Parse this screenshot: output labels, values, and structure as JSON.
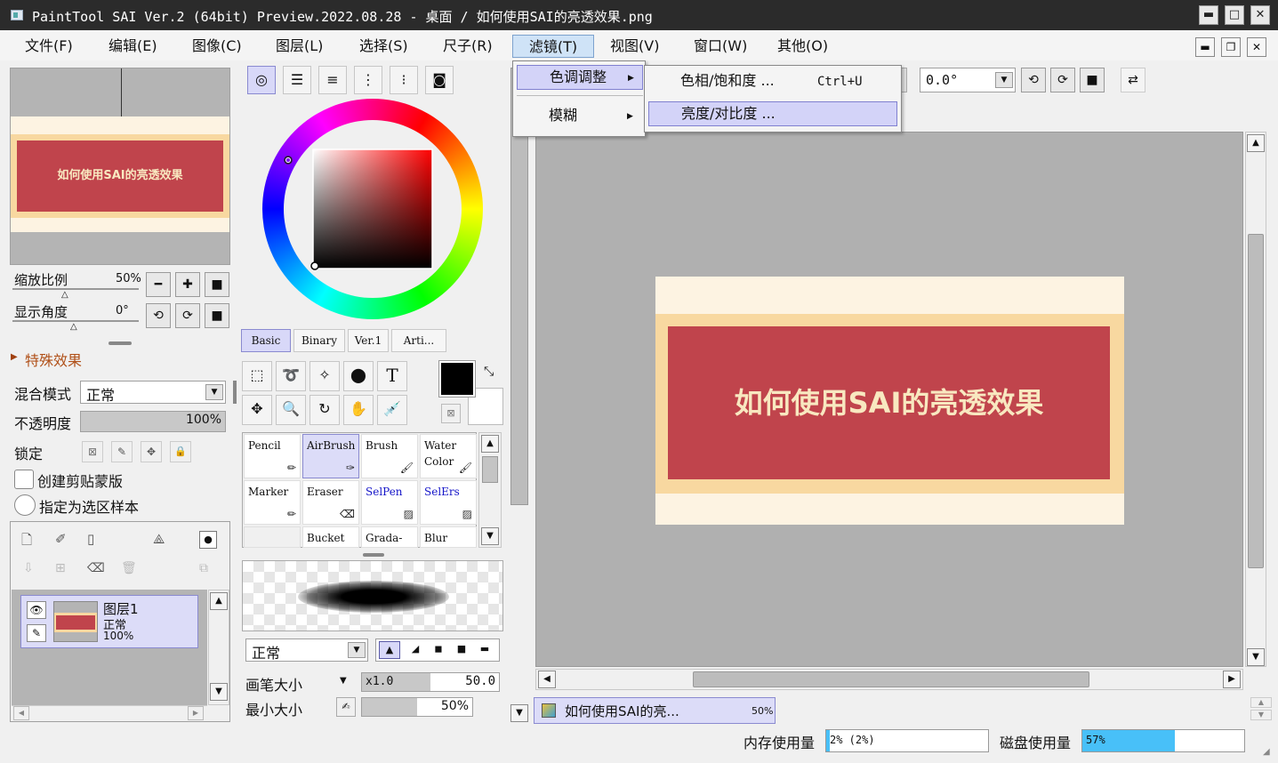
{
  "window": {
    "title": "PaintTool SAI Ver.2 (64bit) Preview.2022.08.28 - 桌面 / 如何使用SAI的亮透效果.png",
    "min_label": "▬",
    "max_label": "□",
    "close_label": "✕"
  },
  "menu": [
    {
      "label": "文件(F)"
    },
    {
      "label": "编辑(E)"
    },
    {
      "label": "图像(C)"
    },
    {
      "label": "图层(L)"
    },
    {
      "label": "选择(S)"
    },
    {
      "label": "尺子(R)"
    },
    {
      "label": "滤镜(T)"
    },
    {
      "label": "视图(V)"
    },
    {
      "label": "窗口(W)"
    },
    {
      "label": "其他(O)"
    }
  ],
  "filter_menu": {
    "items": [
      {
        "label": "色调调整",
        "arrow": "▶"
      },
      {
        "label": "模糊",
        "arrow": "▶"
      }
    ],
    "submenu": [
      {
        "label": "色相/饱和度 ...",
        "shortcut": "Ctrl+U"
      },
      {
        "label": "亮度/对比度 ...",
        "shortcut": ""
      }
    ]
  },
  "navigator": {
    "preview_text": "如何使用SAI的亮透效果",
    "zoom_label": "缩放比例",
    "zoom_value": "50%",
    "angle_label": "显示角度",
    "angle_value": "0°"
  },
  "effects": {
    "label": "特殊效果"
  },
  "layer_props": {
    "blend_label": "混合模式",
    "blend_value": "正常",
    "opacity_label": "不透明度",
    "opacity_value": "100%",
    "opacity_fraction": 1.0,
    "lock_label": "锁定",
    "clip_label": "创建剪贴蒙版",
    "sample_label": "指定为选区样本"
  },
  "layers": [
    {
      "name": "图层1",
      "mode": "正常",
      "opacity": "100%"
    }
  ],
  "color_tabs": [
    {
      "label": "Basic"
    },
    {
      "label": "Binary"
    },
    {
      "label": "Ver.1"
    },
    {
      "label": "Arti..."
    }
  ],
  "tools": {
    "text_tool": "T"
  },
  "brushes": [
    {
      "label1": "Pencil",
      "label2": ""
    },
    {
      "label1": "AirBrush",
      "label2": ""
    },
    {
      "label1": "Brush",
      "label2": ""
    },
    {
      "label1": "Water",
      "label2": "Color"
    },
    {
      "label1": "Marker",
      "label2": ""
    },
    {
      "label1": "Eraser",
      "label2": ""
    },
    {
      "label1": "SelPen",
      "label2": ""
    },
    {
      "label1": "SelErs",
      "label2": ""
    },
    {
      "label1": "",
      "label2": ""
    },
    {
      "label1": "Bucket",
      "label2": ""
    },
    {
      "label1": "Grada-",
      "label2": ""
    },
    {
      "label1": "Blur",
      "label2": ""
    }
  ],
  "brush_settings": {
    "mode_value": "正常",
    "size_label": "画笔大小",
    "size_mult": "x1.0",
    "size_value": "50.0",
    "size_fraction": 0.5,
    "min_label": "最小大小",
    "min_value": "50%",
    "min_fraction": 0.5
  },
  "canvas_toolbar": {
    "angle_value": "0.0°"
  },
  "canvas": {
    "title_text": "如何使用SAI的亮透效果",
    "tab_label": "如何使用SAI的亮...",
    "tab_zoom": "50%"
  },
  "status": {
    "mem_label": "内存使用量",
    "mem_value": "2% (2%)",
    "mem_fraction": 0.02,
    "disk_label": "磁盘使用量",
    "disk_value": "57%",
    "disk_fraction": 0.57
  },
  "colors": {
    "banner_red": "#c0444c",
    "banner_border": "#f8d8a0",
    "banner_text": "#f8e8c0",
    "disk_bar": "#48c0f8",
    "selection_purple": "#d8d8f8"
  }
}
